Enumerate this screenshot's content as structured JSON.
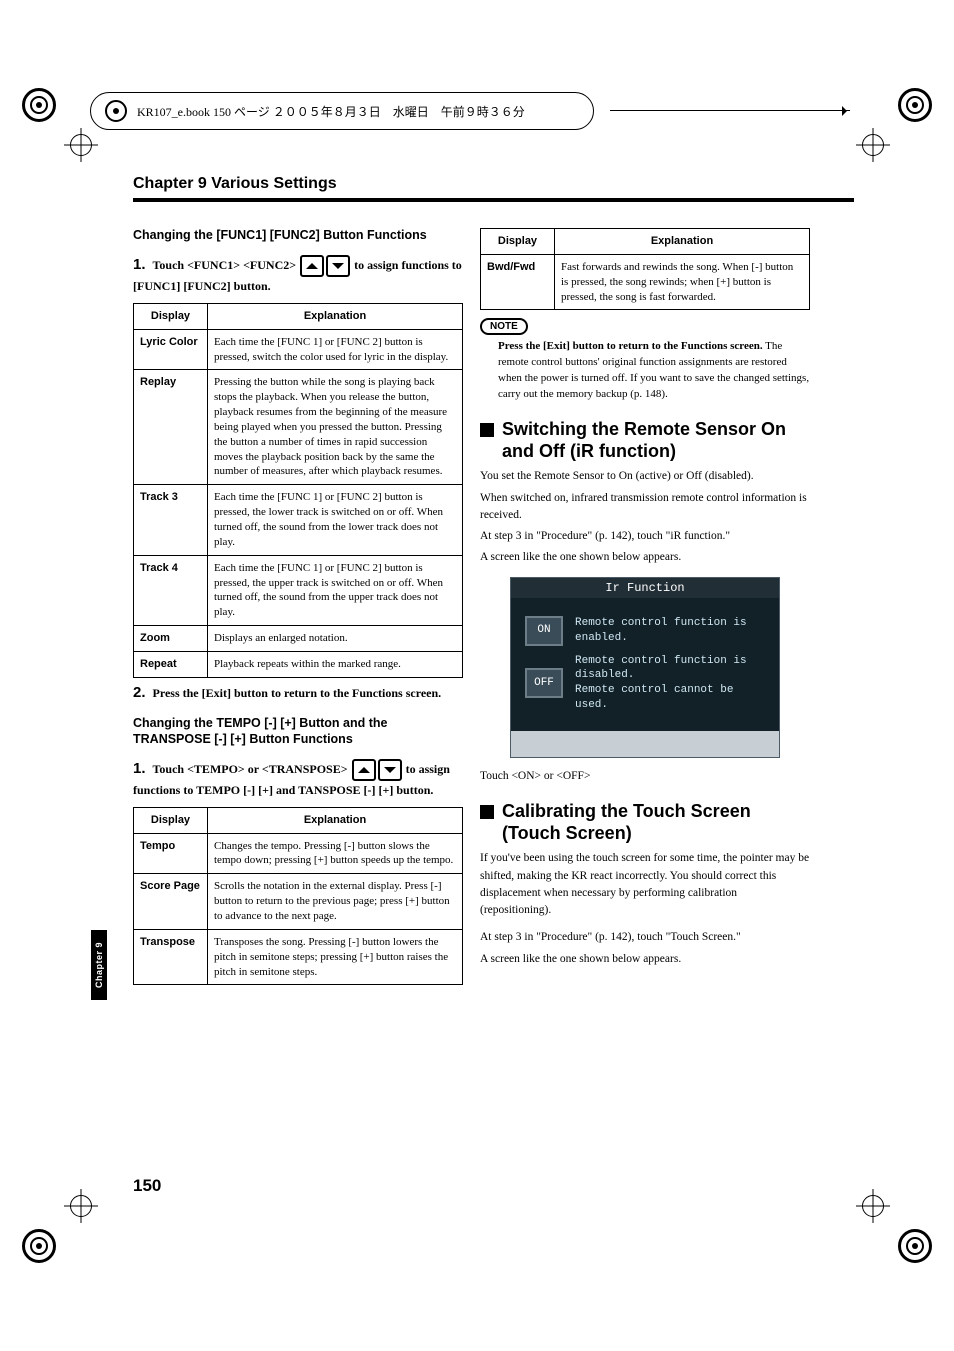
{
  "page_number": "150",
  "side_tab": "Chapter 9",
  "header_bar": "KR107_e.book  150 ページ  ２００５年８月３日　水曜日　午前９時３６分",
  "chapter_title": "Chapter 9 Various Settings",
  "left": {
    "sub1_title": "Changing the [FUNC1] [FUNC2] Button Functions",
    "step1a": "Touch <FUNC1> <FUNC2>",
    "step1b": "to assign functions to [FUNC1] [FUNC2] button.",
    "table1": {
      "head_display": "Display",
      "head_explanation": "Explanation",
      "rows": [
        {
          "k": "Lyric Color",
          "v": "Each time the [FUNC 1] or [FUNC 2] button is pressed, switch the color used for lyric in the display."
        },
        {
          "k": "Replay",
          "v": "Pressing the button while the song is playing back stops the playback. When you release the button, playback resumes from the beginning of the measure being played when you pressed the button. Pressing the button a number of times in rapid succession moves the playback position back by the same the number of measures, after which playback resumes."
        },
        {
          "k": "Track 3",
          "v": "Each time the [FUNC 1] or [FUNC 2] button is pressed, the lower track is switched on or off. When turned off, the sound from the lower track does not play."
        },
        {
          "k": "Track 4",
          "v": "Each time the [FUNC 1] or [FUNC 2] button is pressed, the upper track is switched on or off. When turned off, the sound from the upper track does not play."
        },
        {
          "k": "Zoom",
          "v": "Displays an enlarged notation."
        },
        {
          "k": "Repeat",
          "v": "Playback repeats within the marked range."
        }
      ]
    },
    "step2": "Press the [Exit] button to return to the Functions screen.",
    "sub2_title": "Changing the TEMPO [-] [+] Button and the TRANSPOSE [-] [+] Button Functions",
    "step2_1a": "Touch <TEMPO> or <TRANSPOSE>",
    "step2_1b": "to assign functions to TEMPO [-] [+] and TANSPOSE [-] [+] button.",
    "table2": {
      "head_display": "Display",
      "head_explanation": "Explanation",
      "rows": [
        {
          "k": "Tempo",
          "v": "Changes the tempo. Pressing [-] button slows the tempo down; pressing [+] button speeds up the tempo."
        },
        {
          "k": "Score Page",
          "v": "Scrolls the notation in the external display. Press [-] button to return to the previous page; press [+] button to advance to the next page."
        },
        {
          "k": "Transpose",
          "v": "Transposes the song. Pressing [-] button lowers the pitch in semitone steps; pressing [+] button raises the pitch in semitone steps."
        }
      ]
    }
  },
  "right": {
    "table3": {
      "head_display": "Display",
      "head_explanation": "Explanation",
      "rows": [
        {
          "k": "Bwd/Fwd",
          "v": "Fast forwards and rewinds the song. When [-] button is pressed, the song rewinds; when [+] button is pressed, the song is fast forwarded."
        }
      ]
    },
    "note_label": "NOTE",
    "note_lead": "Press the [Exit] button to return to the Functions screen.",
    "note_rest": "The remote control buttons' original function assignments are restored when the power is turned off. If you want to save the changed settings, carry out the memory backup (p. 148).",
    "sec1_title": "Switching the Remote Sensor On and Off (iR function)",
    "sec1_p1": "You set the Remote Sensor to On (active) or Off (disabled).",
    "sec1_p2": "When switched on, infrared transmission remote control information is received.",
    "sec1_p3": "At step 3 in \"Procedure\" (p. 142), touch \"iR function.\"",
    "sec1_p4": "A screen like the one shown below appears.",
    "screen": {
      "title": "Ir Function",
      "on_label": "ON",
      "on_text": "Remote control function is enabled.",
      "off_label": "OFF",
      "off_text": "Remote control function is disabled.\nRemote control cannot be used."
    },
    "sec1_p5": "Touch <ON> or <OFF>",
    "sec2_title": "Calibrating the Touch Screen (Touch Screen)",
    "sec2_p1": "If you've been using the touch screen for some time, the pointer may be shifted, making the KR react incorrectly. You should correct this displacement when necessary by performing calibration (repositioning).",
    "sec2_p2": "At step 3 in \"Procedure\" (p. 142), touch \"Touch Screen.\"",
    "sec2_p3": "A screen like the one shown below appears."
  }
}
